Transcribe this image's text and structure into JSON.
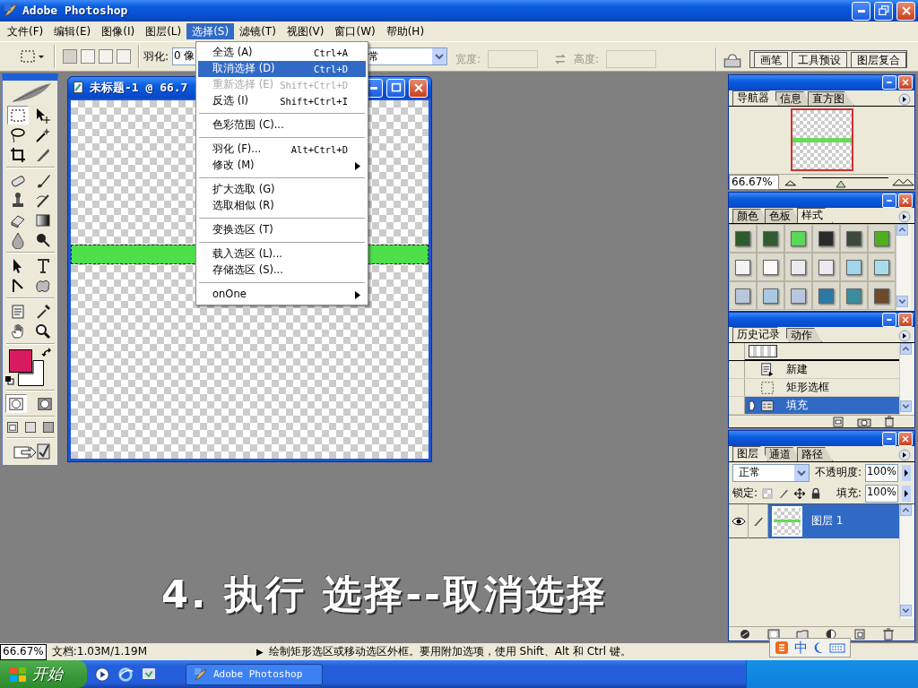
{
  "app_title": "Adobe Photoshop",
  "menu": [
    {
      "label": "文件(F)",
      "selected": false
    },
    {
      "label": "编辑(E)",
      "selected": false
    },
    {
      "label": "图像(I)",
      "selected": false
    },
    {
      "label": "图层(L)",
      "selected": false
    },
    {
      "label": "选择(S)",
      "selected": true
    },
    {
      "label": "滤镜(T)",
      "selected": false
    },
    {
      "label": "视图(V)",
      "selected": false
    },
    {
      "label": "窗口(W)",
      "selected": false
    },
    {
      "label": "帮助(H)",
      "selected": false
    }
  ],
  "options_bar": {
    "feather_label": "羽化:",
    "feather_value": "0 像",
    "style_value": "常",
    "width_label": "宽度:",
    "height_label": "高度:",
    "palette_tabs": [
      "画笔",
      "工具预设",
      "图层复合"
    ]
  },
  "select_menu": [
    {
      "kind": "item",
      "label": "全选 (A)",
      "shortcut": "Ctrl+A",
      "selected": false,
      "disabled": false
    },
    {
      "kind": "item",
      "label": "取消选择 (D)",
      "shortcut": "Ctrl+D",
      "selected": true,
      "disabled": false
    },
    {
      "kind": "item",
      "label": "重新选择 (E)",
      "shortcut": "Shift+Ctrl+D",
      "selected": false,
      "disabled": true
    },
    {
      "kind": "item",
      "label": "反选 (I)",
      "shortcut": "Shift+Ctrl+I",
      "selected": false,
      "disabled": false
    },
    {
      "kind": "separator"
    },
    {
      "kind": "item",
      "label": "色彩范围 (C)...",
      "selected": false,
      "disabled": false
    },
    {
      "kind": "separator"
    },
    {
      "kind": "item",
      "label": "羽化 (F)...",
      "shortcut": "Alt+Ctrl+D",
      "selected": false,
      "disabled": false
    },
    {
      "kind": "submenu",
      "label": "修改 (M)",
      "selected": false,
      "disabled": false
    },
    {
      "kind": "separator"
    },
    {
      "kind": "item",
      "label": "扩大选取 (G)",
      "selected": false,
      "disabled": false
    },
    {
      "kind": "item",
      "label": "选取相似 (R)",
      "selected": false,
      "disabled": false
    },
    {
      "kind": "separator"
    },
    {
      "kind": "item",
      "label": "变换选区 (T)",
      "selected": false,
      "disabled": false
    },
    {
      "kind": "separator"
    },
    {
      "kind": "item",
      "label": "载入选区 (L)...",
      "selected": false,
      "disabled": false
    },
    {
      "kind": "item",
      "label": "存储选区 (S)...",
      "selected": false,
      "disabled": false
    },
    {
      "kind": "separator"
    },
    {
      "kind": "submenu",
      "label": "onOne",
      "selected": false,
      "disabled": false
    }
  ],
  "toolbox": {
    "tools": [
      {
        "selected": true
      },
      {
        "selected": false
      },
      {
        "selected": false
      },
      {
        "selected": false
      },
      {
        "selected": false
      },
      {
        "selected": false
      },
      {
        "selected": false
      },
      {
        "selected": false
      },
      {
        "selected": false
      },
      {
        "selected": false
      },
      {
        "selected": false
      },
      {
        "selected": false
      },
      {
        "selected": false
      },
      {
        "selected": false
      },
      {
        "selected": false
      },
      {
        "selected": false
      },
      {
        "selected": false
      },
      {
        "selected": false
      },
      {
        "selected": false
      },
      {
        "selected": false
      },
      {
        "selected": false
      },
      {
        "selected": false
      }
    ],
    "mask_modes": [
      {
        "selected": true
      },
      {
        "selected": false
      }
    ]
  },
  "document": {
    "title": "未标题-1 @ 66.7"
  },
  "navigator": {
    "tabs": [
      {
        "label": "导航器",
        "selected": true
      },
      {
        "label": "信息",
        "selected": false
      },
      {
        "label": "直方图",
        "selected": false
      }
    ],
    "zoom": "66.67%",
    "level": 0.45
  },
  "styles_palette": {
    "tabs": [
      {
        "label": "颜色",
        "selected": false
      },
      {
        "label": "色板",
        "selected": false
      },
      {
        "label": "样式",
        "selected": true
      }
    ]
  },
  "history": {
    "tabs": [
      {
        "label": "历史记录",
        "selected": true
      },
      {
        "label": "动作",
        "selected": false
      }
    ],
    "items": [
      {
        "label": "新建",
        "selected": false
      },
      {
        "label": "矩形选框",
        "selected": false
      },
      {
        "label": "填充",
        "selected": true
      }
    ]
  },
  "layers": {
    "tabs": [
      {
        "label": "图层",
        "selected": true
      },
      {
        "label": "通道",
        "selected": false
      },
      {
        "label": "路径",
        "selected": false
      }
    ],
    "blend_mode": "正常",
    "opacity_label": "不透明度:",
    "opacity": "100%",
    "lock_label": "锁定:",
    "fill_label": "填充:",
    "fill": "100%",
    "items": [
      {
        "name": "图层 1",
        "selected": true,
        "visible": true
      }
    ]
  },
  "caption": "4. 执行 选择--取消选择",
  "status_bar": {
    "zoom": "66.67%",
    "doc_info": "文档:1.03M/1.19M",
    "arrow": "▶",
    "hint": "绘制矩形选区或移动选区外框。要用附加选项，使用 Shift、Alt 和 Ctrl 键。"
  },
  "ime": {
    "mode": "中"
  },
  "taskbar": {
    "start": "开始",
    "tasks": [
      {
        "label": "Adobe Photoshop",
        "selected": false
      }
    ]
  }
}
